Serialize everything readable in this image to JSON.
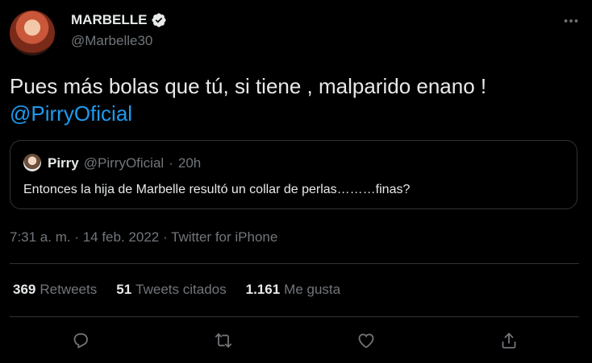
{
  "author": {
    "display_name": "MARBELLE",
    "handle": "@Marbelle30",
    "verified": true
  },
  "tweet": {
    "text": "Pues más bolas que tú, si tiene , malparido enano !",
    "mention": "@PirryOficial"
  },
  "quoted": {
    "name": "Pirry",
    "handle": "@PirryOficial",
    "separator": "·",
    "age": "20h",
    "text": "Entonces la hija de Marbelle resultó un collar de perlas………finas?"
  },
  "timestamp": "7:31 a. m. · 14 feb. 2022 · Twitter for iPhone",
  "stats": [
    {
      "count": "369",
      "label": "Retweets"
    },
    {
      "count": "51",
      "label": "Tweets citados"
    },
    {
      "count": "1.161",
      "label": "Me gusta"
    }
  ],
  "icons": {
    "more": "more-icon",
    "reply": "reply-icon",
    "retweet": "retweet-icon",
    "like": "heart-icon",
    "share": "share-icon"
  },
  "colors": {
    "background": "#000000",
    "text": "#e7e9ea",
    "muted": "#71767b",
    "link": "#1d9bf0",
    "border": "#2f3336"
  }
}
